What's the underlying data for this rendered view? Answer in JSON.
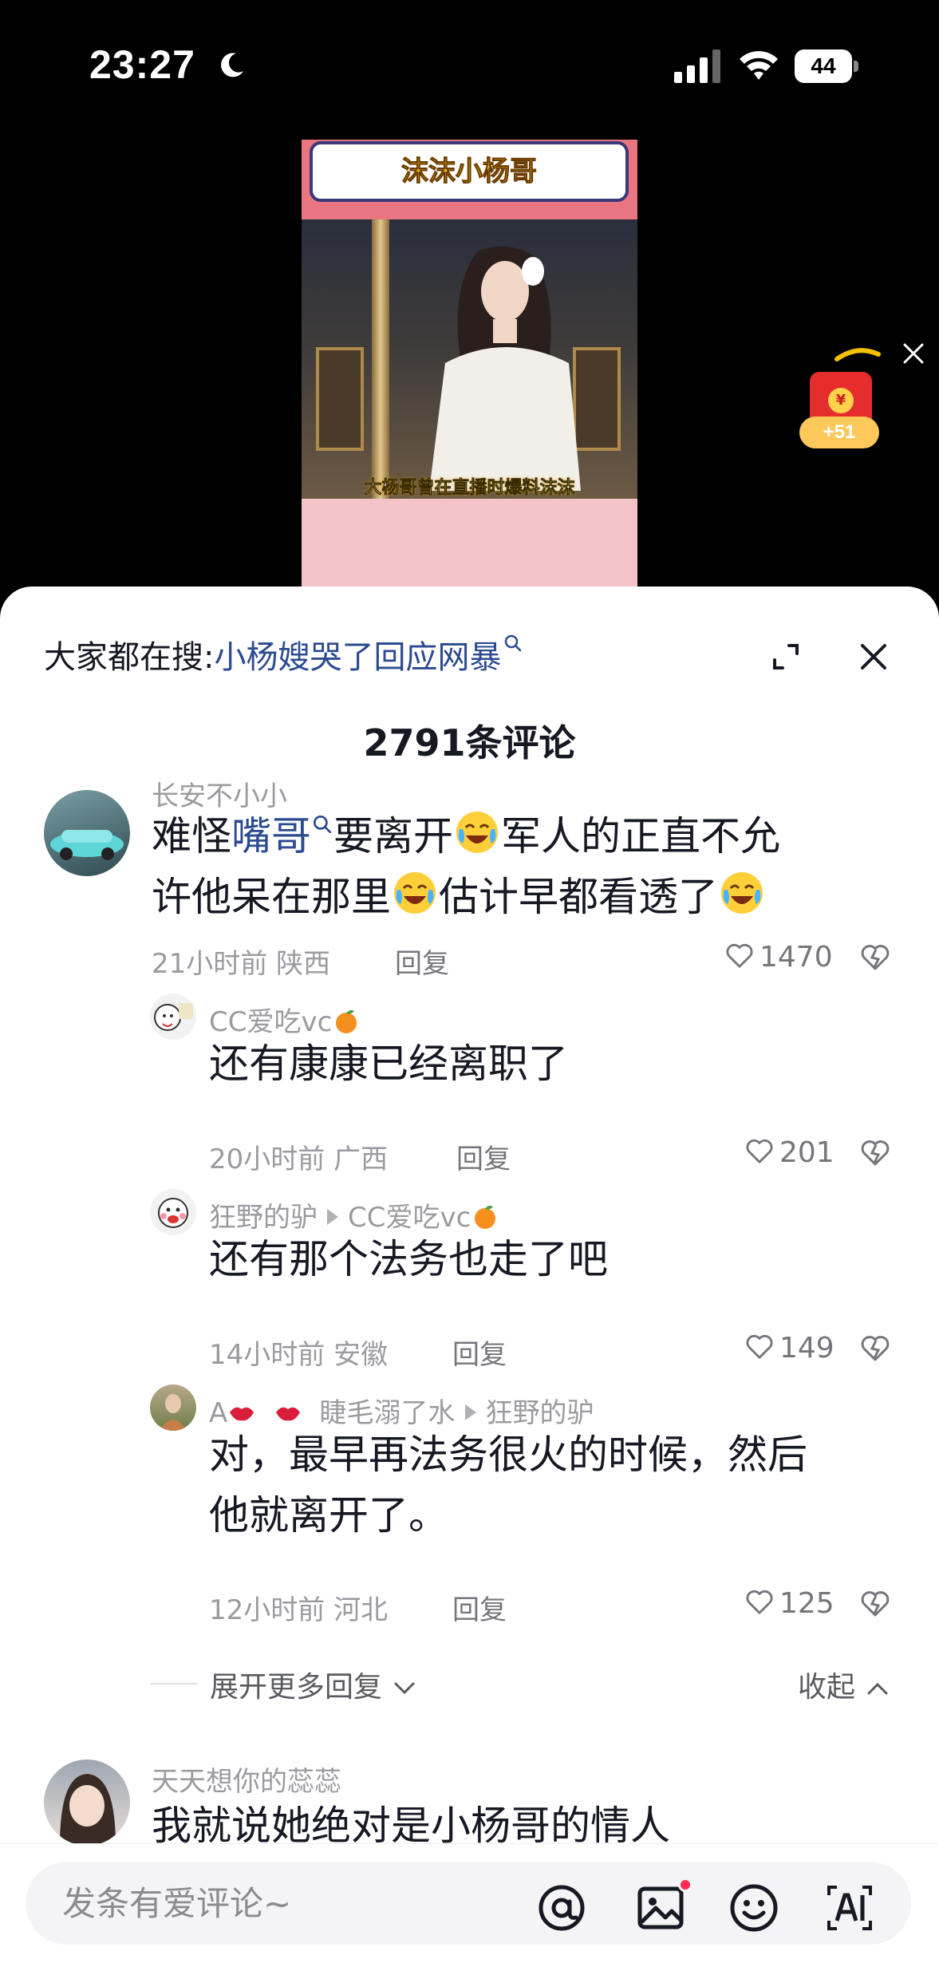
{
  "status": {
    "time": "23:27",
    "battery": "44"
  },
  "video": {
    "title": "沫沫小杨哥",
    "caption": "大杨哥曾在直播时爆料沫沫"
  },
  "red_envelope": {
    "badge": "+51",
    "coin": "¥"
  },
  "sheet": {
    "search_prefix": "大家都在搜:",
    "search_term": "小杨嫂哭了回应网暴",
    "comment_count": "2791条评论"
  },
  "comments": [
    {
      "username": "长安不小小",
      "text_a": "难怪",
      "link": "嘴哥",
      "text_b": "要离开",
      "text_c": "军人的正直不允",
      "text_d": "许他呆在那里",
      "text_e": "估计早都看透了",
      "time_loc": "21小时前 陕西",
      "reply_label": "回复",
      "likes": "1470"
    },
    {
      "username": "CC爱吃vc",
      "text": "还有康康已经离职了",
      "time_loc": "20小时前 广西",
      "reply_label": "回复",
      "likes": "201"
    },
    {
      "username": "狂野的驴",
      "reply_to": "CC爱吃vc",
      "text": "还有那个法务也走了吧",
      "time_loc": "14小时前 安徽",
      "reply_label": "回复",
      "likes": "149"
    },
    {
      "username": "A",
      "reply_to_user": "睫毛溺了水",
      "reply_to": "狂野的驴",
      "text_line1": "对，最早再法务很火的时候，然后",
      "text_line2": "他就离开了。",
      "time_loc": "12小时前 河北",
      "reply_label": "回复",
      "likes": "125"
    },
    {
      "username": "天天想你的蕊蕊",
      "text": "我就说她绝对是小杨哥的情人"
    }
  ],
  "expand": {
    "more": "展开更多回复",
    "collapse": "收起"
  },
  "input": {
    "placeholder": "发条有爱评论~"
  },
  "colors": {
    "accent": "#fe2c55",
    "link": "#2b4a8f",
    "muted": "#9a9ba0"
  }
}
